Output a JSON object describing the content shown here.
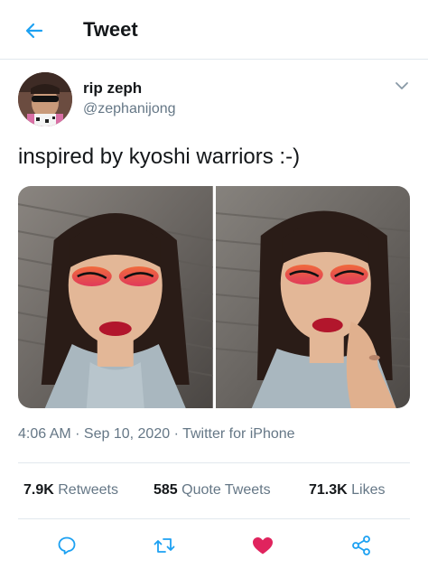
{
  "header": {
    "title": "Tweet",
    "back_icon": "arrow-left-icon"
  },
  "colors": {
    "accent": "#1da1f2",
    "muted": "#657786",
    "like": "#e0245e",
    "text": "#14171a"
  },
  "author": {
    "display_name": "rip zeph",
    "handle": "@zephanijong",
    "avatar_icon": "avatar-image",
    "menu_icon": "chevron-down-icon"
  },
  "tweet": {
    "text": "inspired by kyoshi warriors :-)"
  },
  "media": {
    "count": 2
  },
  "meta": {
    "time": "4:06 AM",
    "separator": " · ",
    "date": "Sep 10, 2020",
    "source": "Twitter for iPhone"
  },
  "stats": {
    "retweets_count": "7.9K",
    "retweets_label": "Retweets",
    "quotes_count": "585",
    "quotes_label": "Quote Tweets",
    "likes_count": "71.3K",
    "likes_label": "Likes"
  },
  "actions": {
    "reply_icon": "reply-icon",
    "retweet_icon": "retweet-icon",
    "like_icon": "heart-filled-icon",
    "share_icon": "share-icon"
  }
}
